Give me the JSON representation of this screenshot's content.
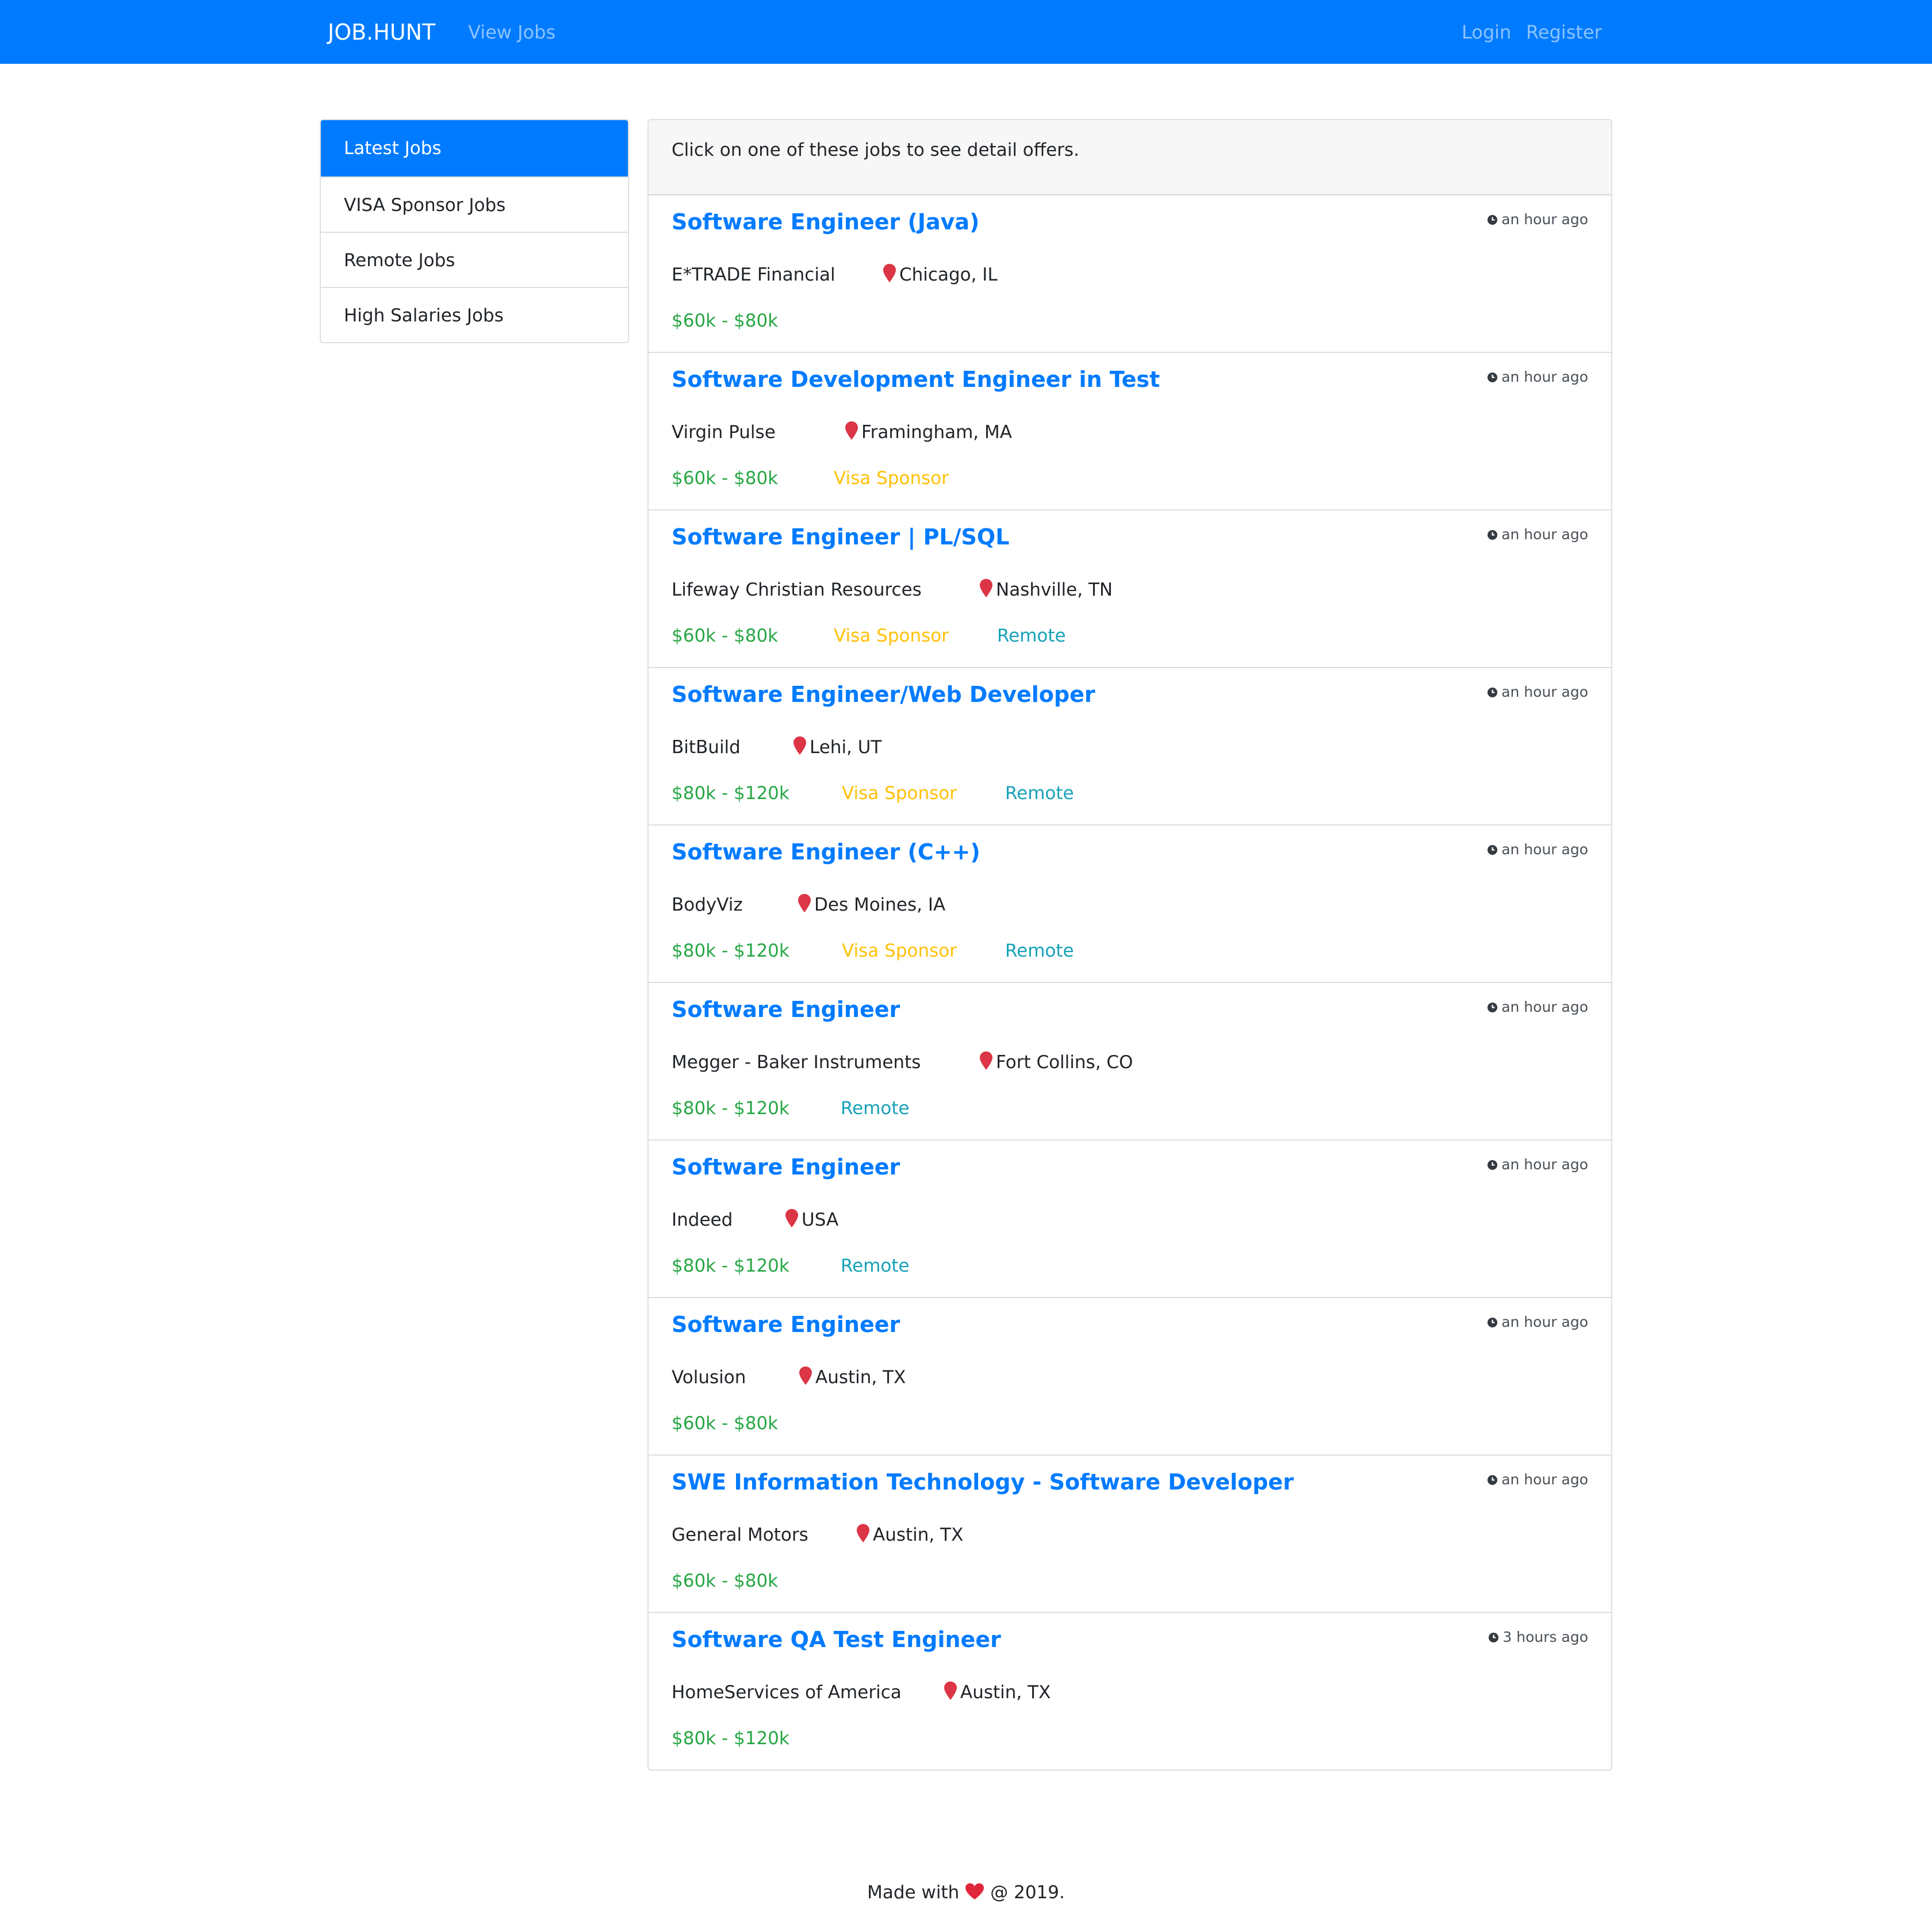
{
  "navbar": {
    "brand": "JOB.HUNT",
    "view_jobs": "View Jobs",
    "login": "Login",
    "register": "Register",
    "bg_color": "#007bff"
  },
  "sidebar": {
    "items": [
      {
        "label": "Latest Jobs",
        "active": true
      },
      {
        "label": "VISA Sponsor Jobs",
        "active": false
      },
      {
        "label": "Remote Jobs",
        "active": false
      },
      {
        "label": "High Salaries Jobs",
        "active": false
      }
    ]
  },
  "card": {
    "header": "Click on one of these jobs to see detail offers."
  },
  "jobs": [
    {
      "title": "Software Engineer (Java)",
      "company": "E*TRADE Financial",
      "location": "Chicago, IL",
      "salary": "$60k - $80k",
      "visa": null,
      "remote": null,
      "time": "an hour ago"
    },
    {
      "title": "Software Development Engineer in Test",
      "company": "Virgin Pulse",
      "location": "Framingham, MA",
      "salary": "$60k - $80k",
      "visa": "Visa Sponsor",
      "remote": null,
      "time": "an hour ago"
    },
    {
      "title": "Software Engineer | PL/SQL",
      "company": "Lifeway Christian Resources",
      "location": "Nashville, TN",
      "salary": "$60k - $80k",
      "visa": "Visa Sponsor",
      "remote": "Remote",
      "time": "an hour ago"
    },
    {
      "title": "Software Engineer/Web Developer",
      "company": "BitBuild",
      "location": "Lehi, UT",
      "salary": "$80k - $120k",
      "visa": "Visa Sponsor",
      "remote": "Remote",
      "time": "an hour ago"
    },
    {
      "title": "Software Engineer (C++)",
      "company": "BodyViz",
      "location": "Des Moines, IA",
      "salary": "$80k - $120k",
      "visa": "Visa Sponsor",
      "remote": "Remote",
      "time": "an hour ago"
    },
    {
      "title": "Software Engineer",
      "company": "Megger - Baker Instruments",
      "location": "Fort Collins, CO",
      "salary": "$80k - $120k",
      "visa": null,
      "remote": "Remote",
      "time": "an hour ago"
    },
    {
      "title": "Software Engineer",
      "company": "Indeed",
      "location": "USA",
      "salary": "$80k - $120k",
      "visa": null,
      "remote": "Remote",
      "time": "an hour ago"
    },
    {
      "title": "Software Engineer",
      "company": "Volusion",
      "location": "Austin, TX",
      "salary": "$60k - $80k",
      "visa": null,
      "remote": null,
      "time": "an hour ago"
    },
    {
      "title": "SWE Information Technology - Software Developer",
      "company": "General Motors",
      "location": "Austin, TX",
      "salary": "$60k - $80k",
      "visa": null,
      "remote": null,
      "time": "an hour ago"
    },
    {
      "title": "Software QA Test Engineer",
      "company": "HomeServices of America",
      "location": "Austin, TX",
      "salary": "$80k - $120k",
      "visa": null,
      "remote": null,
      "time": "3 hours ago"
    }
  ],
  "footer": {
    "before": "Made with",
    "after": "@ 2019.",
    "icon": "heart-icon"
  },
  "icons": {
    "time": "clock-icon",
    "location": "map-pin-icon"
  },
  "colors": {
    "primary": "#007bff",
    "salary": "#28a745",
    "visa": "#ffc107",
    "remote": "#17a2b8",
    "pin": "#dc3545"
  }
}
